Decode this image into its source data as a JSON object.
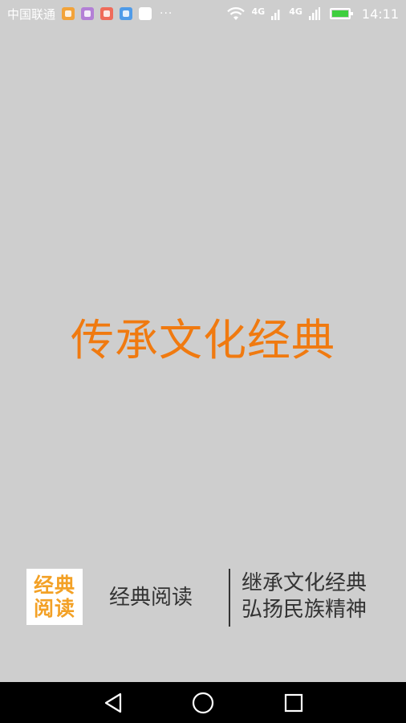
{
  "status_bar": {
    "carrier": "中国联通",
    "notification_icons": [
      {
        "icon": "taobao-icon",
        "color": "#f2a33a"
      },
      {
        "icon": "gallery-icon",
        "color": "#b37fd6"
      },
      {
        "icon": "app-icon",
        "color": "#ef6b5a"
      },
      {
        "icon": "wifi-app-icon",
        "color": "#4f9be8"
      },
      {
        "icon": "baidu-icon",
        "color": "#ffffff"
      }
    ],
    "more": "···",
    "network_1": "4G",
    "network_2": "4G",
    "battery_color": "#3fcf3f",
    "time": "14:11"
  },
  "splash": {
    "slogan": "传承文化经典",
    "slogan_color": "#f07a10"
  },
  "brand": {
    "logo_line1": "经典",
    "logo_line2": "阅读",
    "logo_color": "#f3a126",
    "name": "经典阅读",
    "tagline_line1": "继承文化经典",
    "tagline_line2": "弘扬民族精神"
  },
  "nav_bar": {
    "back_icon": "back-triangle-icon",
    "home_icon": "home-circle-icon",
    "recents_icon": "recents-square-icon"
  }
}
